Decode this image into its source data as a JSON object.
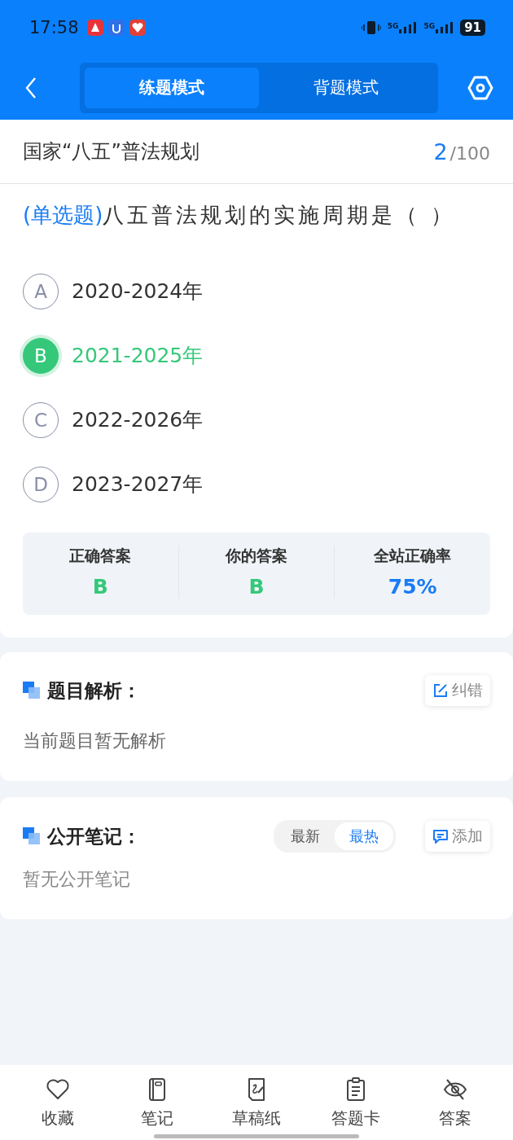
{
  "status_bar": {
    "time": "17:58",
    "network": [
      "5G",
      "5G"
    ],
    "battery": "91"
  },
  "header": {
    "tabs": [
      {
        "label": "练题模式",
        "selected": true
      },
      {
        "label": "背题模式",
        "selected": false
      }
    ]
  },
  "question": {
    "title": "国家“八五”普法规划",
    "current": "2",
    "total": "/100",
    "type": "(单选题)",
    "text": "八五普法规划的实施周期是（ ）"
  },
  "options": [
    {
      "letter": "A",
      "text": "2020-2024年",
      "selected": false
    },
    {
      "letter": "B",
      "text": "2021-2025年",
      "selected": true
    },
    {
      "letter": "C",
      "text": "2022-2026年",
      "selected": false
    },
    {
      "letter": "D",
      "text": "2023-2027年",
      "selected": false
    }
  ],
  "stats": [
    {
      "label": "正确答案",
      "value": "B",
      "kind": "answer"
    },
    {
      "label": "你的答案",
      "value": "B",
      "kind": "answer"
    },
    {
      "label": "全站正确率",
      "value": "75%",
      "kind": "rate"
    }
  ],
  "analysis": {
    "title": "题目解析：",
    "button": "纠错",
    "text": "当前题目暂无解析"
  },
  "notes": {
    "title": "公开笔记：",
    "sort": [
      {
        "label": "最新",
        "selected": false
      },
      {
        "label": "最热",
        "selected": true
      }
    ],
    "button": "添加",
    "text": "暂无公开笔记"
  },
  "bottom_nav": [
    {
      "label": "收藏",
      "kind": "heart"
    },
    {
      "label": "笔记",
      "kind": "notebook"
    },
    {
      "label": "草稿纸",
      "kind": "draft"
    },
    {
      "label": "答题卡",
      "kind": "clipboard"
    },
    {
      "label": "答案",
      "kind": "eye-off"
    }
  ]
}
